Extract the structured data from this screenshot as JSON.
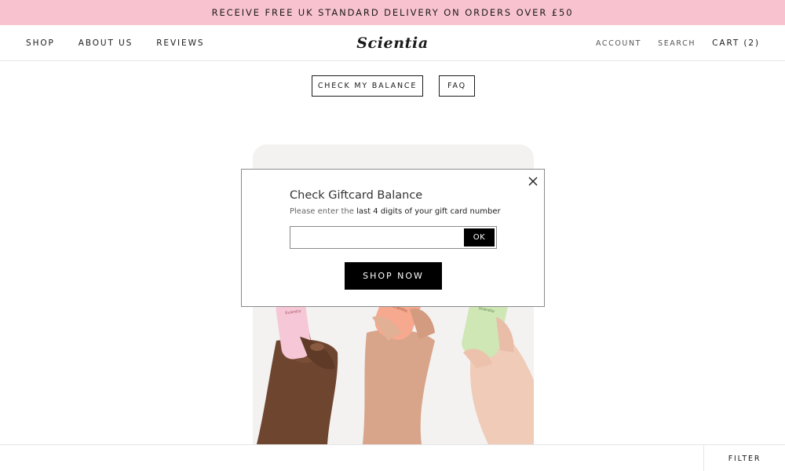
{
  "promo": {
    "text": "RECEIVE FREE UK STANDARD DELIVERY ON ORDERS OVER £50"
  },
  "nav": {
    "left": [
      {
        "label": "SHOP"
      },
      {
        "label": "ABOUT US"
      },
      {
        "label": "REVIEWS"
      }
    ],
    "logo": "Scientia",
    "right": {
      "account": "ACCOUNT",
      "search": "SEARCH",
      "cart": "CART (2)"
    }
  },
  "actions": {
    "check_balance": "CHECK MY BALANCE",
    "faq": "FAQ"
  },
  "modal": {
    "title": "Check Giftcard Balance",
    "subtitle_prefix": "Please enter the",
    "subtitle_emphasis": "last 4 digits of your gift card number",
    "input_value": "",
    "ok_label": "OK",
    "shop_now_label": "SHOP NOW"
  },
  "hero": {
    "bottle_labels": [
      "Scientia",
      "Scientia",
      "Scientia"
    ],
    "colors": {
      "pink_bottle": "#f6c7d6",
      "peach_bottle": "#f7a98f",
      "green_bottle": "#cfe6b5",
      "background": "#f3f2f1"
    }
  },
  "footer": {
    "filter": "FILTER"
  },
  "colors": {
    "promo_bg": "#f8c3cf",
    "text": "#1c1b1b",
    "button_bg": "#000000"
  }
}
